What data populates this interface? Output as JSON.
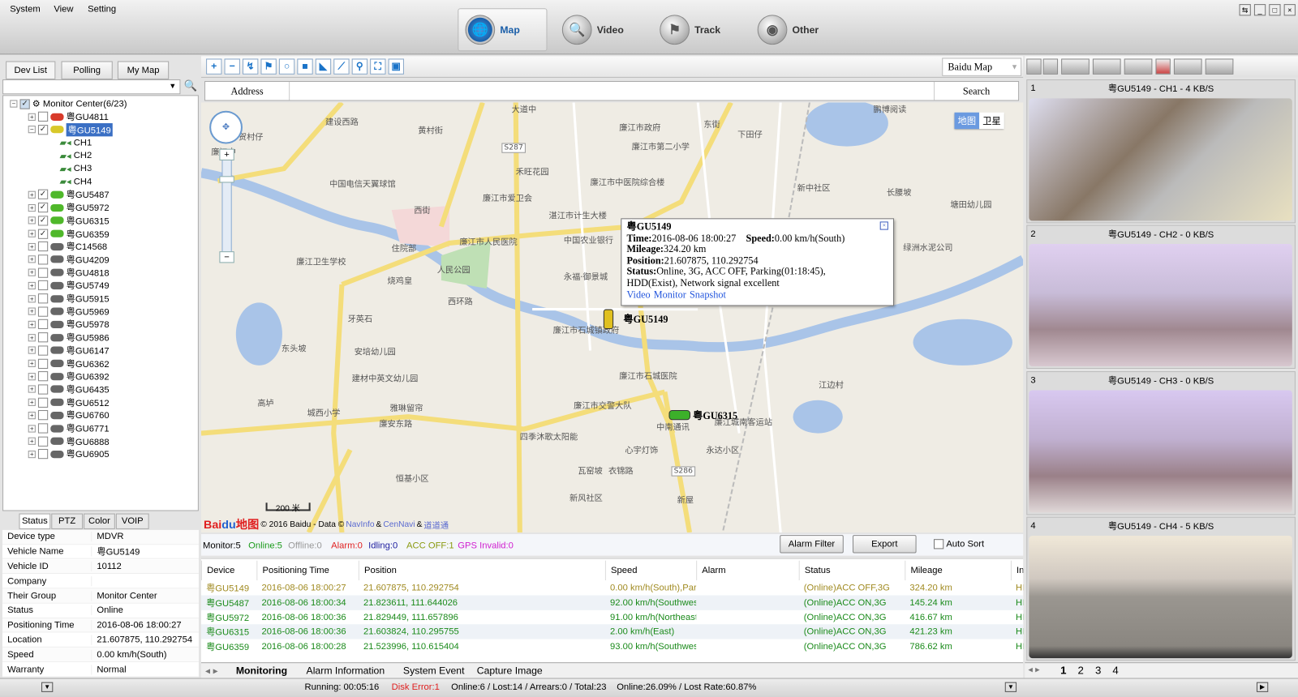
{
  "menu": [
    "System",
    "View",
    "Setting"
  ],
  "nav": [
    {
      "label": "Map",
      "icon": "globe-icon",
      "active": true
    },
    {
      "label": "Video",
      "icon": "camera-icon"
    },
    {
      "label": "Track",
      "icon": "track-icon"
    },
    {
      "label": "Other",
      "icon": "gear-icon"
    }
  ],
  "left_tabs": [
    "Dev List",
    "Polling",
    "My Map"
  ],
  "tree": {
    "root": "Monitor Center(6/23)",
    "selected": "粤GU5149",
    "channels": [
      "CH1",
      "CH2",
      "CH3",
      "CH4"
    ],
    "devices": [
      {
        "name": "粤GU4811",
        "status": "alarm",
        "checked": false
      },
      {
        "name": "粤GU5149",
        "status": "parking",
        "checked": true,
        "expanded": true
      },
      {
        "name": "粤GU5487",
        "status": "online",
        "checked": true
      },
      {
        "name": "粤GU5972",
        "status": "online",
        "checked": true
      },
      {
        "name": "粤GU6315",
        "status": "online",
        "checked": true
      },
      {
        "name": "粤GU6359",
        "status": "online",
        "checked": true
      },
      {
        "name": "粤C14568",
        "status": "offline",
        "checked": false
      },
      {
        "name": "粤GU4209",
        "status": "offline",
        "checked": false
      },
      {
        "name": "粤GU4818",
        "status": "offline",
        "checked": false
      },
      {
        "name": "粤GU5749",
        "status": "offline",
        "checked": false
      },
      {
        "name": "粤GU5915",
        "status": "offline",
        "checked": false
      },
      {
        "name": "粤GU5969",
        "status": "offline",
        "checked": false
      },
      {
        "name": "粤GU5978",
        "status": "offline",
        "checked": false
      },
      {
        "name": "粤GU5986",
        "status": "offline",
        "checked": false
      },
      {
        "name": "粤GU6147",
        "status": "offline",
        "checked": false
      },
      {
        "name": "粤GU6362",
        "status": "offline",
        "checked": false
      },
      {
        "name": "粤GU6392",
        "status": "offline",
        "checked": false
      },
      {
        "name": "粤GU6435",
        "status": "offline",
        "checked": false
      },
      {
        "name": "粤GU6512",
        "status": "offline",
        "checked": false
      },
      {
        "name": "粤GU6760",
        "status": "offline",
        "checked": false
      },
      {
        "name": "粤GU6771",
        "status": "offline",
        "checked": false
      },
      {
        "name": "粤GU6888",
        "status": "offline",
        "checked": false
      },
      {
        "name": "粤GU6905",
        "status": "offline",
        "checked": false
      }
    ]
  },
  "status_colors": {
    "alarm": "#d83a2a",
    "parking": "#d8c82a",
    "online": "#4fb82a",
    "offline": "#666666"
  },
  "status_tabs": [
    "Status",
    "PTZ",
    "Color",
    "VOIP"
  ],
  "status_table": [
    [
      "Device type",
      "MDVR"
    ],
    [
      "Vehicle Name",
      "粤GU5149"
    ],
    [
      "Vehicle ID",
      "10112"
    ],
    [
      "Company",
      ""
    ],
    [
      "Their Group",
      "Monitor Center"
    ],
    [
      "Status",
      "Online"
    ],
    [
      "Positioning Time",
      "2016-08-06 18:00:27"
    ],
    [
      "Location",
      "21.607875, 110.292754"
    ],
    [
      "Speed",
      "0.00 km/h(South)"
    ],
    [
      "Warranty",
      "Normal"
    ]
  ],
  "map": {
    "type": "Baidu Map",
    "address_label": "Address",
    "search_label": "Search",
    "map_btn": "地图",
    "sat_btn": "卫星",
    "scale": "200 米",
    "copyright": "© 2016 Baidu - Data © ",
    "providers": [
      "NavInfo",
      "CenNavi",
      "道道通"
    ],
    "amp": " & ",
    "labels": [
      "建设西路",
      "黄村街",
      "东街",
      "大道中",
      "廉江市政府",
      "廉江市第二小学",
      "下田仔",
      "鹏博阅读",
      "禾旺花园",
      "廉江市中医院综合楼",
      "新中社区",
      "长腰坡",
      "塘田幼儿园",
      "中国电信天翼球馆",
      "廉江市爱卫会",
      "湛江市计生大楼",
      "西街",
      "住院部",
      "廉江市人民医院",
      "中国农业银行",
      "绿洲水泥公司",
      "廉江卫生学校",
      "人民公园",
      "永福·御景城",
      "烧鸡皇",
      "西环路",
      "牙英石",
      "廉江市石城镇政府",
      "东头坡",
      "安培幼儿园",
      "廉江市石城医院",
      "建材中英文幼儿园",
      "江边村",
      "高垆",
      "雅琳留帘",
      "廉江市交警大队",
      "城西小学",
      "廉安东路",
      "四季沐歌太阳能",
      "中南通讯",
      "廉江城南客运站",
      "心宇灯饰",
      "永达小区",
      "恒基小区",
      "衣锦路",
      "瓦窑坡",
      "新风社区",
      "新屋",
      "S287",
      "S286",
      "贺村仔",
      "廉江中"
    ],
    "markers": [
      {
        "name": "粤GU5149",
        "status": "parking"
      },
      {
        "name": "粤GU6315",
        "status": "online"
      }
    ]
  },
  "popup": {
    "title": "粤GU5149",
    "time_label": "Time:",
    "time": "2016-08-06 18:00:27",
    "speed_label": "Speed:",
    "speed": "0.00 km/h(South)",
    "mileage_label": "Mileage:",
    "mileage": "324.20 km",
    "position_label": "Position:",
    "position": "21.607875, 110.292754",
    "status_label": "Status:",
    "status": "Online, 3G, ACC OFF, Parking(01:18:45),",
    "status2": "HDD(Exist), Network signal excellent",
    "links": [
      "Video",
      "Monitor",
      "Snapshot"
    ]
  },
  "summary": {
    "monitor": "Monitor:5",
    "online": "Online:5",
    "offline": "Offline:0",
    "alarm": "Alarm:0",
    "idling": "Idling:0",
    "accoff": "ACC OFF:1",
    "gps": "GPS Invalid:0",
    "alarm_filter": "Alarm Filter",
    "export": "Export",
    "auto_sort": "Auto Sort"
  },
  "grid": {
    "headers": [
      "Device",
      "Positioning Time",
      "Position",
      "Speed",
      "Alarm",
      "Status",
      "Mileage",
      "In"
    ],
    "rows": [
      {
        "c": [
          "粤GU5149",
          "2016-08-06 18:00:27",
          "21.607875, 110.292754",
          "0.00 km/h(South),Park",
          "",
          "(Online)ACC OFF,3G",
          "324.20 km",
          "HD"
        ],
        "color": "#a08a20"
      },
      {
        "c": [
          "粤GU5487",
          "2016-08-06 18:00:34",
          "21.823611, 111.644026",
          "92.00 km/h(Southwest",
          "",
          "(Online)ACC ON,3G",
          "145.24 km",
          "HD"
        ],
        "color": "#1a8a1a"
      },
      {
        "c": [
          "粤GU5972",
          "2016-08-06 18:00:36",
          "21.829449, 111.657896",
          "91.00 km/h(Northeast",
          "",
          "(Online)ACC ON,3G",
          "416.67 km",
          "HD"
        ],
        "color": "#1a8a1a"
      },
      {
        "c": [
          "粤GU6315",
          "2016-08-06 18:00:36",
          "21.603824, 110.295755",
          "2.00 km/h(East)",
          "",
          "(Online)ACC ON,3G",
          "421.23 km",
          "HD"
        ],
        "color": "#1a8a1a"
      },
      {
        "c": [
          "粤GU6359",
          "2016-08-06 18:00:28",
          "21.523996, 110.615404",
          "93.00 km/h(Southwest",
          "",
          "(Online)ACC ON,3G",
          "786.62 km",
          "HD"
        ],
        "color": "#1a8a1a"
      }
    ]
  },
  "bottom_tabs": [
    "Monitoring",
    "Alarm Information",
    "System Event",
    "Capture Image"
  ],
  "statusbar": {
    "running": "Running: 00:05:16",
    "disk": "Disk Error:1",
    "counts": "Online:6 / Lost:14 / Arrears:0 / Total:23",
    "rate": "Online:26.09% / Lost Rate:60.87%"
  },
  "video": [
    {
      "n": "1",
      "title": "粤GU5149 - CH1 - 4 KB/S"
    },
    {
      "n": "2",
      "title": "粤GU5149 - CH2 - 0 KB/S"
    },
    {
      "n": "3",
      "title": "粤GU5149 - CH3 - 0 KB/S"
    },
    {
      "n": "4",
      "title": "粤GU5149 - CH4 - 5 KB/S"
    }
  ],
  "video_pages": [
    "1",
    "2",
    "3",
    "4"
  ]
}
